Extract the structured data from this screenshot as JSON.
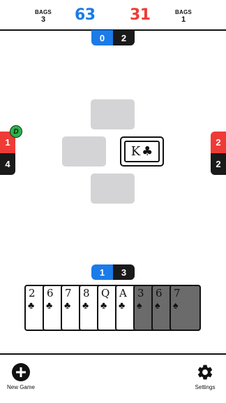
{
  "colors": {
    "team_blue": "#1b7be8",
    "team_red": "#ef3b36",
    "dark": "#1a1a1a",
    "slot": "#d4d4d6",
    "dealer_badge": "#2eb24b"
  },
  "scoreboard": {
    "left_bags_label": "BAGS",
    "left_bags_value": "3",
    "blue_score": "63",
    "red_score": "31",
    "right_bags_label": "BAGS",
    "right_bags_value": "1"
  },
  "players": {
    "north": {
      "bid": "0",
      "tricks": "2"
    },
    "west": {
      "bid": "1",
      "tricks": "4",
      "dealer_badge": "D"
    },
    "east": {
      "bid": "2",
      "tricks": "2"
    },
    "south": {
      "bid": "1",
      "tricks": "3"
    }
  },
  "trick": {
    "played_card": {
      "rank": "K",
      "suit": "♣",
      "player": "east"
    },
    "empty_slots": [
      "north",
      "west",
      "south"
    ]
  },
  "hand": [
    {
      "rank": "2",
      "suit": "♣",
      "playable": true
    },
    {
      "rank": "6",
      "suit": "♣",
      "playable": true
    },
    {
      "rank": "7",
      "suit": "♣",
      "playable": true
    },
    {
      "rank": "8",
      "suit": "♣",
      "playable": true
    },
    {
      "rank": "Q",
      "suit": "♣",
      "playable": true
    },
    {
      "rank": "A",
      "suit": "♣",
      "playable": true
    },
    {
      "rank": "3",
      "suit": "♠",
      "playable": false
    },
    {
      "rank": "6",
      "suit": "♠",
      "playable": false
    },
    {
      "rank": "7",
      "suit": "♠",
      "playable": false
    }
  ],
  "bottom_bar": {
    "new_game_label": "New Game",
    "new_game_icon": "plus-circle-icon",
    "settings_label": "Settings",
    "settings_icon": "gear-icon"
  }
}
